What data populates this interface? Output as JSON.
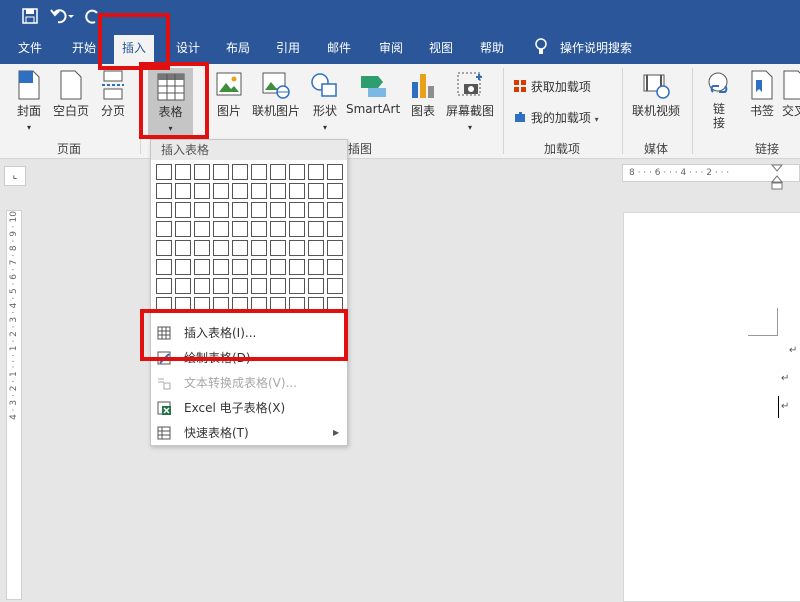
{
  "tabs": [
    "文件",
    "开始",
    "插入",
    "设计",
    "布局",
    "引用",
    "邮件",
    "审阅",
    "视图",
    "帮助"
  ],
  "tell_me": "操作说明搜索",
  "ribbon": {
    "pages_group": {
      "cover": "封面",
      "blank": "空白页",
      "break": "分页",
      "label": "页面"
    },
    "table_btn": "表格",
    "pictures": "图片",
    "online_pictures": "联机图片",
    "shapes": "形状",
    "smartart": "SmartArt",
    "chart": "图表",
    "screenshot": "屏幕截图",
    "illus_label": "插图",
    "get_addins": "获取加载项",
    "my_addins": "我的加载项",
    "addins_label": "加载项",
    "online_video": "联机视频",
    "media_label": "媒体",
    "link": "链接",
    "bookmark": "书签",
    "crossref": "交叉",
    "links_label": "链接"
  },
  "dropdown": {
    "header": "插入表格",
    "grid_rows": 8,
    "grid_cols": 10,
    "items": [
      {
        "label": "插入表格(I)...",
        "icon": "table-icon",
        "disabled": false
      },
      {
        "label": "绘制表格(D)",
        "icon": "pencil-table-icon",
        "disabled": false
      },
      {
        "label": "文本转换成表格(V)...",
        "icon": "text-to-table-icon",
        "disabled": true
      },
      {
        "label": "Excel 电子表格(X)",
        "icon": "excel-icon",
        "disabled": false
      },
      {
        "label": "快速表格(T)",
        "icon": "quick-table-icon",
        "disabled": false
      }
    ]
  },
  "ruler_h": "8 · · · 6 · · · 4 · · · 2 · · ·",
  "ruler_v": "4 · 3 · 2 · 1 · · · 1 · 2 · 3 · 4 · 5 · 6 · 7 · 8 · 9 · 10"
}
